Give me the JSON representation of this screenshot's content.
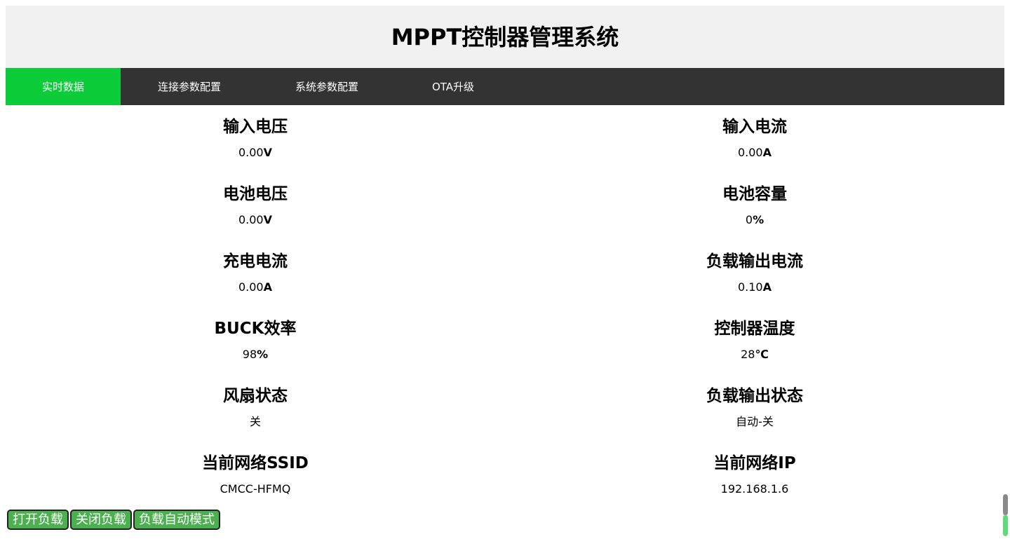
{
  "header": {
    "title": "MPPT控制器管理系统"
  },
  "nav": {
    "tabs": [
      {
        "label": "实时数据",
        "active": true
      },
      {
        "label": "连接参数配置",
        "active": false
      },
      {
        "label": "系统参数配置",
        "active": false
      },
      {
        "label": "OTA升级",
        "active": false
      }
    ]
  },
  "metrics": {
    "input_voltage": {
      "label": "输入电压",
      "value": "0.00",
      "unit": "V"
    },
    "input_current": {
      "label": "输入电流",
      "value": "0.00",
      "unit": "A"
    },
    "battery_voltage": {
      "label": "电池电压",
      "value": "0.00",
      "unit": "V"
    },
    "battery_capacity": {
      "label": "电池容量",
      "value": "0",
      "unit": "%"
    },
    "charge_current": {
      "label": "充电电流",
      "value": "0.00",
      "unit": "A"
    },
    "load_output_current": {
      "label": "负载输出电流",
      "value": "0.10",
      "unit": "A"
    },
    "buck_efficiency": {
      "label": "BUCK效率",
      "value": "98",
      "unit": "%"
    },
    "controller_temp": {
      "label": "控制器温度",
      "value": "28",
      "unit": "℃"
    },
    "fan_status": {
      "label": "风扇状态",
      "value": "关",
      "unit": ""
    },
    "load_output_status": {
      "label": "负载输出状态",
      "value": "自动-关",
      "unit": ""
    },
    "network_ssid": {
      "label": "当前网络SSID",
      "value": "CMCC-HFMQ",
      "unit": ""
    },
    "network_ip": {
      "label": "当前网络IP",
      "value": "192.168.1.6",
      "unit": ""
    }
  },
  "buttons": {
    "open_load": "打开负载",
    "close_load": "关闭负载",
    "auto_mode": "负载自动模式"
  },
  "colors": {
    "active_tab": "#0ccd39",
    "nav_bg": "#333333",
    "header_bg": "#f1f1f1",
    "button_bg": "#4caf50"
  }
}
